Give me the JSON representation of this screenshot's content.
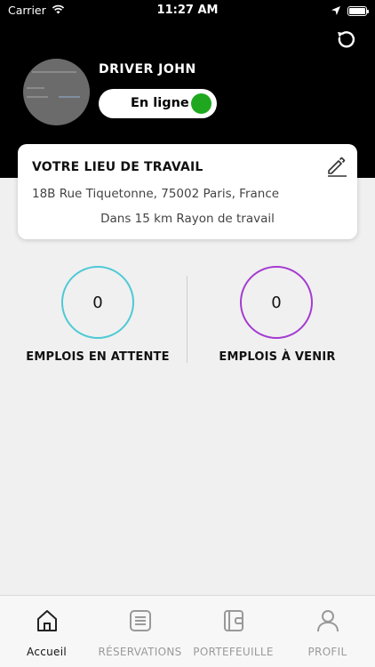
{
  "status_bar": {
    "carrier": "Carrier",
    "time": "11:27 AM"
  },
  "profile": {
    "name": "DRIVER JOHN",
    "status_label": "En ligne",
    "online_color": "#1fa81f"
  },
  "workplace": {
    "title": "VOTRE LIEU DE TRAVAIL",
    "address": "18B Rue Tiquetonne,  75002 Paris,  France",
    "radius_text": "Dans 15 km Rayon de travail"
  },
  "stats": {
    "pending": {
      "count": "0",
      "label": "EMPLOIS EN ATTENTE",
      "color": "#4ec9d6"
    },
    "upcoming": {
      "count": "0",
      "label": "EMPLOIS À VENIR",
      "color": "#a43bd1"
    }
  },
  "tabs": [
    {
      "label": "Accueil",
      "icon": "home-icon",
      "active": true
    },
    {
      "label": "RÉSERVATIONS",
      "icon": "list-icon",
      "active": false
    },
    {
      "label": "PORTEFEUILLE",
      "icon": "wallet-icon",
      "active": false
    },
    {
      "label": "PROFIL",
      "icon": "user-icon",
      "active": false
    }
  ]
}
